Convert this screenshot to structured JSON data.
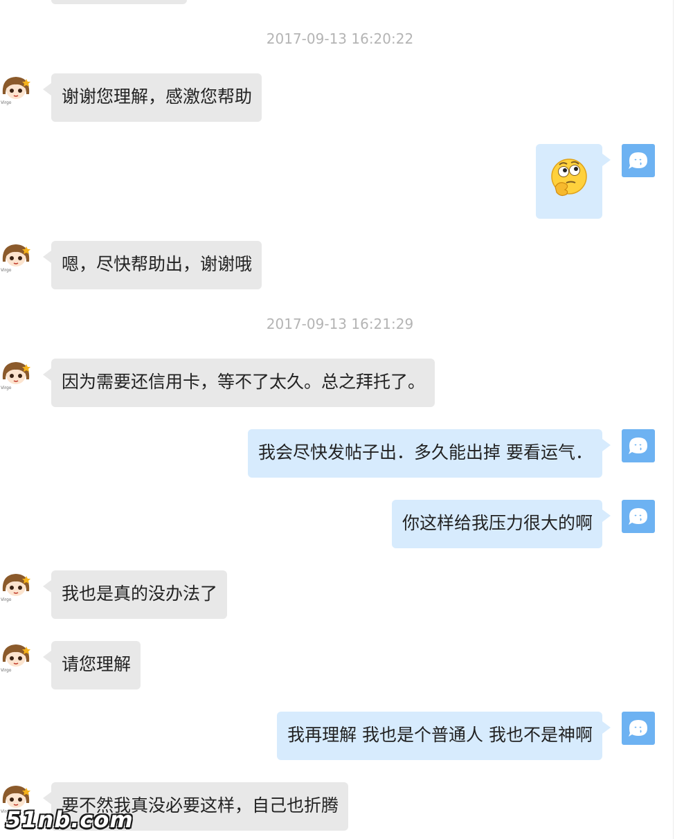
{
  "chat": {
    "timestamps": [
      "2017-09-13 16:20:22",
      "2017-09-13 16:21:29"
    ],
    "messages": [
      {
        "sender": "user",
        "text": "谢谢您理解，感激您帮助"
      },
      {
        "sender": "agent",
        "emoji": "thinking-face-emoji"
      },
      {
        "sender": "user",
        "text": "嗯，尽快帮助出，谢谢哦"
      },
      {
        "sender": "user",
        "text": "因为需要还信用卡，等不了太久。总之拜托了。"
      },
      {
        "sender": "agent",
        "text": "我会尽快发帖子出．多久能出掉 要看运气．"
      },
      {
        "sender": "agent",
        "text": "你这样给我压力很大的啊"
      },
      {
        "sender": "user",
        "text": "我也是真的没办法了"
      },
      {
        "sender": "user",
        "text": "请您理解"
      },
      {
        "sender": "agent",
        "text": "我再理解 我也是个普通人 我也不是神啊"
      },
      {
        "sender": "user",
        "text": "要不然我真没必要这样，自己也折腾"
      }
    ],
    "user_avatar_caption": "Virgo"
  },
  "watermark": {
    "text": "51nb.com",
    "dot_color": "#e8231f"
  },
  "colors": {
    "user_bubble": "#e8e8e8",
    "agent_bubble": "#d7ebfd",
    "agent_avatar": "#6db2f2",
    "timestamp": "#b4b4b4"
  }
}
